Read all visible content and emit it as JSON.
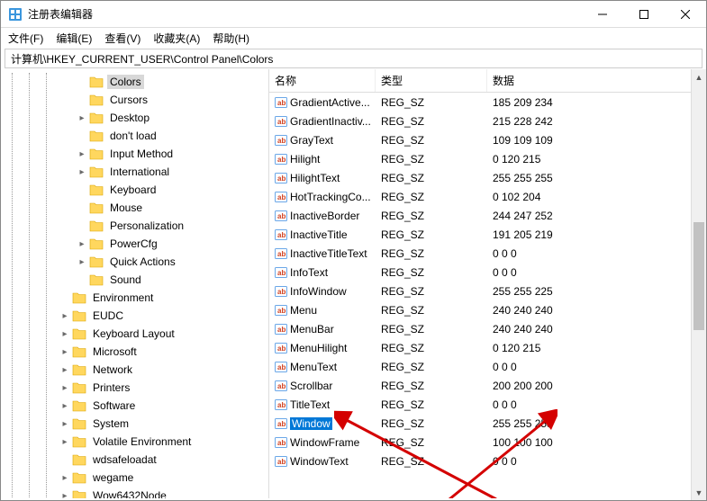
{
  "window": {
    "title": "注册表编辑器"
  },
  "menu": {
    "file": "文件(F)",
    "edit": "编辑(E)",
    "view": "查看(V)",
    "favorites": "收藏夹(A)",
    "help": "帮助(H)"
  },
  "address": "计算机\\HKEY_CURRENT_USER\\Control Panel\\Colors",
  "tree": [
    {
      "label": "Colors",
      "depth": 4,
      "exp": "",
      "selected": true
    },
    {
      "label": "Cursors",
      "depth": 4,
      "exp": ""
    },
    {
      "label": "Desktop",
      "depth": 4,
      "exp": ">"
    },
    {
      "label": "don't load",
      "depth": 4,
      "exp": ""
    },
    {
      "label": "Input Method",
      "depth": 4,
      "exp": ">"
    },
    {
      "label": "International",
      "depth": 4,
      "exp": ">"
    },
    {
      "label": "Keyboard",
      "depth": 4,
      "exp": ""
    },
    {
      "label": "Mouse",
      "depth": 4,
      "exp": ""
    },
    {
      "label": "Personalization",
      "depth": 4,
      "exp": ""
    },
    {
      "label": "PowerCfg",
      "depth": 4,
      "exp": ">"
    },
    {
      "label": "Quick Actions",
      "depth": 4,
      "exp": ">"
    },
    {
      "label": "Sound",
      "depth": 4,
      "exp": ""
    },
    {
      "label": "Environment",
      "depth": 3,
      "exp": ""
    },
    {
      "label": "EUDC",
      "depth": 3,
      "exp": ">"
    },
    {
      "label": "Keyboard Layout",
      "depth": 3,
      "exp": ">"
    },
    {
      "label": "Microsoft",
      "depth": 3,
      "exp": ">"
    },
    {
      "label": "Network",
      "depth": 3,
      "exp": ">"
    },
    {
      "label": "Printers",
      "depth": 3,
      "exp": ">"
    },
    {
      "label": "Software",
      "depth": 3,
      "exp": ">"
    },
    {
      "label": "System",
      "depth": 3,
      "exp": ">"
    },
    {
      "label": "Volatile Environment",
      "depth": 3,
      "exp": ">"
    },
    {
      "label": "wdsafeloadat",
      "depth": 3,
      "exp": ""
    },
    {
      "label": "wegame",
      "depth": 3,
      "exp": ">"
    },
    {
      "label": "Wow6432Node",
      "depth": 3,
      "exp": ">"
    }
  ],
  "columns": {
    "name": "名称",
    "type": "类型",
    "data": "数据"
  },
  "values": [
    {
      "name": "GradientActive...",
      "type": "REG_SZ",
      "data": "185 209 234"
    },
    {
      "name": "GradientInactiv...",
      "type": "REG_SZ",
      "data": "215 228 242"
    },
    {
      "name": "GrayText",
      "type": "REG_SZ",
      "data": "109 109 109"
    },
    {
      "name": "Hilight",
      "type": "REG_SZ",
      "data": "0 120 215"
    },
    {
      "name": "HilightText",
      "type": "REG_SZ",
      "data": "255 255 255"
    },
    {
      "name": "HotTrackingCo...",
      "type": "REG_SZ",
      "data": "0 102 204"
    },
    {
      "name": "InactiveBorder",
      "type": "REG_SZ",
      "data": "244 247 252"
    },
    {
      "name": "InactiveTitle",
      "type": "REG_SZ",
      "data": "191 205 219"
    },
    {
      "name": "InactiveTitleText",
      "type": "REG_SZ",
      "data": "0 0 0"
    },
    {
      "name": "InfoText",
      "type": "REG_SZ",
      "data": "0 0 0"
    },
    {
      "name": "InfoWindow",
      "type": "REG_SZ",
      "data": "255 255 225"
    },
    {
      "name": "Menu",
      "type": "REG_SZ",
      "data": "240 240 240"
    },
    {
      "name": "MenuBar",
      "type": "REG_SZ",
      "data": "240 240 240"
    },
    {
      "name": "MenuHilight",
      "type": "REG_SZ",
      "data": "0 120 215"
    },
    {
      "name": "MenuText",
      "type": "REG_SZ",
      "data": "0 0 0"
    },
    {
      "name": "Scrollbar",
      "type": "REG_SZ",
      "data": "200 200 200"
    },
    {
      "name": "TitleText",
      "type": "REG_SZ",
      "data": "0 0 0"
    },
    {
      "name": "Window",
      "type": "REG_SZ",
      "data": "255 255 255",
      "selected": true
    },
    {
      "name": "WindowFrame",
      "type": "REG_SZ",
      "data": "100 100 100"
    },
    {
      "name": "WindowText",
      "type": "REG_SZ",
      "data": "0 0 0"
    }
  ]
}
